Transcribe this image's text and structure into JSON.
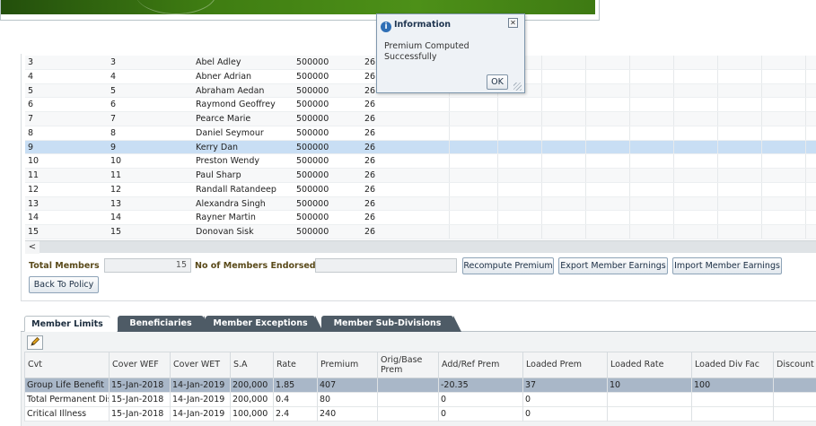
{
  "members_grid": {
    "rows": [
      {
        "c1": "3",
        "c2": "3",
        "name": "Abel Adley",
        "amount": "500000",
        "c5": "26"
      },
      {
        "c1": "4",
        "c2": "4",
        "name": "Abner Adrian",
        "amount": "500000",
        "c5": "26"
      },
      {
        "c1": "5",
        "c2": "5",
        "name": "Abraham Aedan",
        "amount": "500000",
        "c5": "26"
      },
      {
        "c1": "6",
        "c2": "6",
        "name": "Raymond Geoffrey",
        "amount": "500000",
        "c5": "26"
      },
      {
        "c1": "7",
        "c2": "7",
        "name": "Pearce Marie",
        "amount": "500000",
        "c5": "26"
      },
      {
        "c1": "8",
        "c2": "8",
        "name": "Daniel Seymour",
        "amount": "500000",
        "c5": "26"
      },
      {
        "c1": "9",
        "c2": "9",
        "name": "Kerry Dan",
        "amount": "500000",
        "c5": "26"
      },
      {
        "c1": "10",
        "c2": "10",
        "name": "Preston Wendy",
        "amount": "500000",
        "c5": "26"
      },
      {
        "c1": "11",
        "c2": "11",
        "name": "Paul Sharp",
        "amount": "500000",
        "c5": "26"
      },
      {
        "c1": "12",
        "c2": "12",
        "name": "Randall Ratandeep",
        "amount": "500000",
        "c5": "26"
      },
      {
        "c1": "13",
        "c2": "13",
        "name": "Alexandra Singh",
        "amount": "500000",
        "c5": "26"
      },
      {
        "c1": "14",
        "c2": "14",
        "name": "Rayner Martin",
        "amount": "500000",
        "c5": "26"
      },
      {
        "c1": "15",
        "c2": "15",
        "name": "Donovan Sisk",
        "amount": "500000",
        "c5": "26"
      }
    ],
    "selected_row": "9",
    "scroll_left_glyph": "<"
  },
  "summary": {
    "total_members_label": "Total Members",
    "total_members_value": "15",
    "endorsed_label": "No of Members Endorsed",
    "endorsed_value": "",
    "recompute_button": "Recompute Premium",
    "export_button": "Export Member Earnings",
    "import_button": "Import Member Earnings",
    "back_button": "Back To Policy"
  },
  "tabs": [
    {
      "label": "Member Limits",
      "active": true
    },
    {
      "label": "Beneficiaries",
      "active": false
    },
    {
      "label": "Member Exceptions",
      "active": false
    },
    {
      "label": "Member Sub-Divisions",
      "active": false
    }
  ],
  "limits_table": {
    "edit_icon": "pencil-icon",
    "headers": [
      "Cvt",
      "Cover WEF",
      "Cover WET",
      "S.A",
      "Rate",
      "Premium",
      "Orig/Base Prem",
      "Add/Ref Prem",
      "Loaded Prem",
      "Loaded Rate",
      "Loaded Div Fac",
      "Discount R"
    ],
    "rows": [
      [
        "Group Life Benefit",
        "15-Jan-2018",
        "14-Jan-2019",
        "200,000",
        "1.85",
        "407",
        "",
        "-20.35",
        "37",
        "10",
        "100",
        ""
      ],
      [
        "Total Permanent Disability",
        "15-Jan-2018",
        "14-Jan-2019",
        "200,000",
        "0.4",
        "80",
        "",
        "0",
        "0",
        "",
        "",
        ""
      ],
      [
        "Critical Illness",
        "15-Jan-2018",
        "14-Jan-2019",
        "100,000",
        "2.4",
        "240",
        "",
        "0",
        "0",
        "",
        "",
        ""
      ]
    ]
  },
  "dialog": {
    "title": "Information",
    "message": "Premium Computed Successfully",
    "ok_label": "OK",
    "close_glyph": "✕",
    "info_glyph": "i"
  },
  "colors": {
    "banner_green": "#3f7d12",
    "selected_row": "#c8def4",
    "tab_dark": "#4e5b66"
  }
}
